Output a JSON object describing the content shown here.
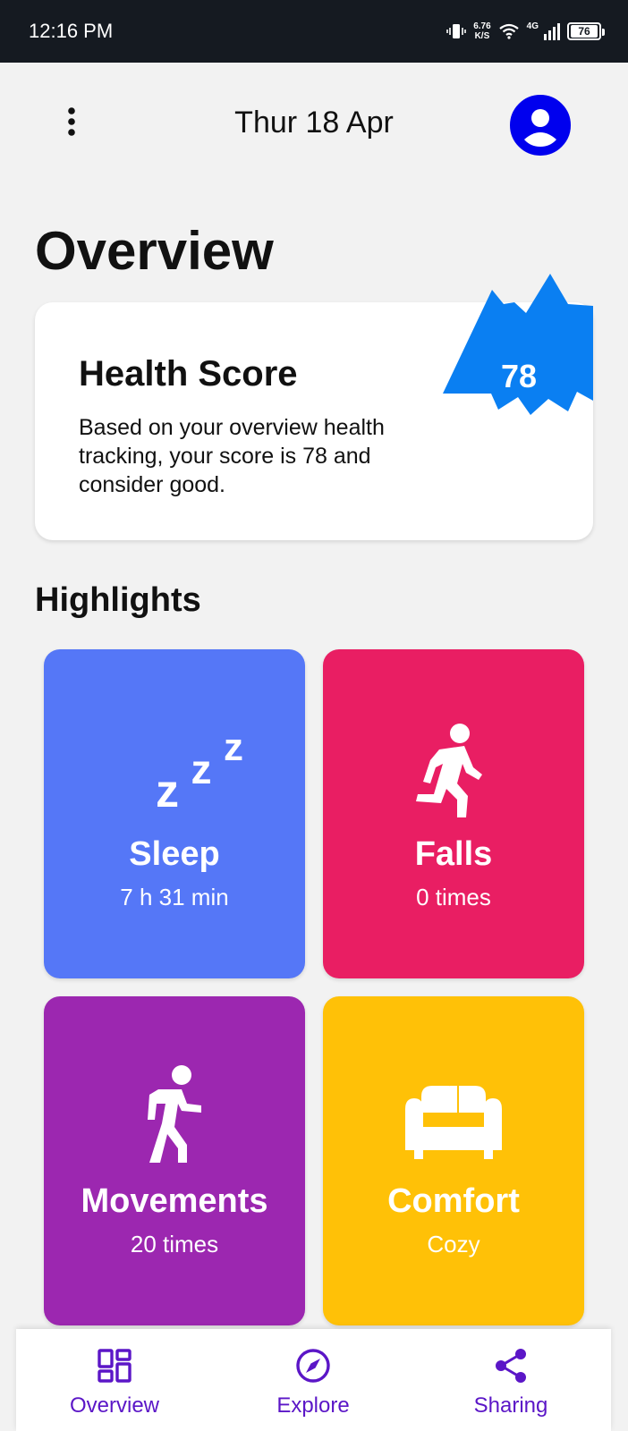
{
  "status_bar": {
    "time": "12:16 PM",
    "speed_value": "6.76",
    "speed_unit": "K/S",
    "network": "4G",
    "battery": "76"
  },
  "header": {
    "date": "Thur 18 Apr",
    "menu_icon": "more-vertical-icon",
    "avatar_icon": "account-circle-icon"
  },
  "page": {
    "title": "Overview"
  },
  "health_score": {
    "title": "Health Score",
    "description": "Based on your overview health tracking, your score is 78 and consider good.",
    "score": "78",
    "badge_color": "#0a7ff2"
  },
  "highlights": {
    "title": "Highlights",
    "tiles": [
      {
        "title": "Sleep",
        "value": "7 h 31 min",
        "icon": "zzz-sleep-icon",
        "color": "#5577f7"
      },
      {
        "title": "Falls",
        "value": "0 times",
        "icon": "running-person-icon",
        "color": "#e91e63"
      },
      {
        "title": "Movements",
        "value": "20 times",
        "icon": "walking-person-icon",
        "color": "#9c27b0"
      },
      {
        "title": "Comfort",
        "value": "Cozy",
        "icon": "sofa-icon",
        "color": "#ffc107"
      }
    ]
  },
  "bottom_nav": {
    "items": [
      {
        "label": "Overview",
        "icon": "dashboard-icon"
      },
      {
        "label": "Explore",
        "icon": "compass-icon"
      },
      {
        "label": "Sharing",
        "icon": "share-icon"
      }
    ],
    "color": "#5b16c7"
  }
}
